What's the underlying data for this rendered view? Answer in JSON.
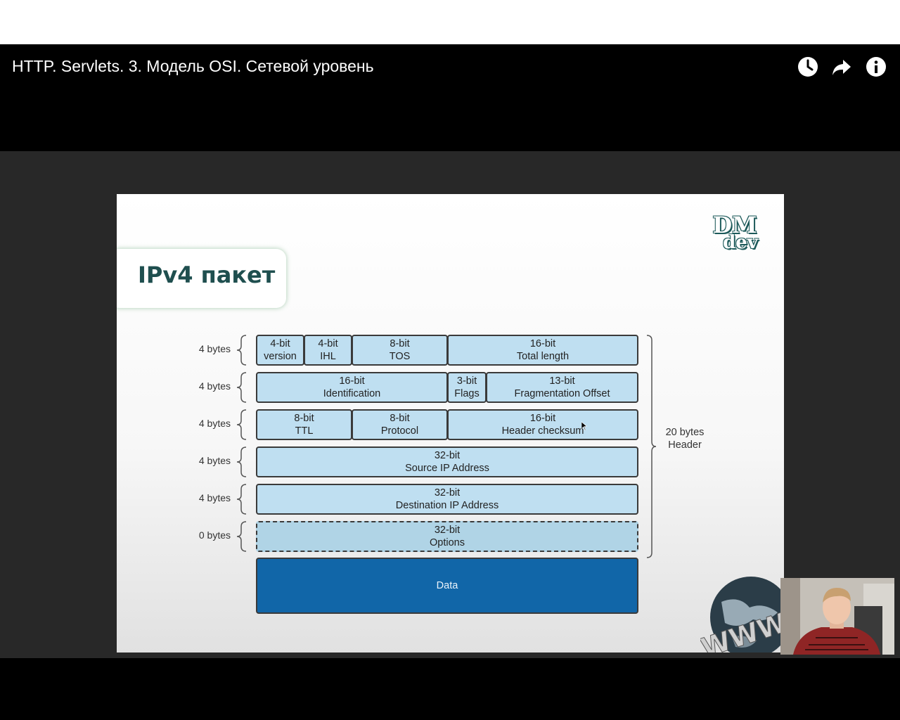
{
  "video": {
    "title": "HTTP. Servlets. 3. Модель OSI. Сетевой уровень",
    "icons": [
      "clock-icon",
      "share-icon",
      "info-icon"
    ]
  },
  "slide": {
    "title": "IPv4 пакет",
    "logo": {
      "line1": "DM",
      "line2": "dev"
    },
    "rows": [
      {
        "label": "4 bytes",
        "fields": [
          {
            "bits": "4-bit",
            "name": "version"
          },
          {
            "bits": "4-bit",
            "name": "IHL"
          },
          {
            "bits": "8-bit",
            "name": "TOS"
          },
          {
            "bits": "16-bit",
            "name": "Total length"
          }
        ]
      },
      {
        "label": "4 bytes",
        "fields": [
          {
            "bits": "16-bit",
            "name": "Identification"
          },
          {
            "bits": "3-bit",
            "name": "Flags"
          },
          {
            "bits": "13-bit",
            "name": "Fragmentation Offset"
          }
        ]
      },
      {
        "label": "4 bytes",
        "fields": [
          {
            "bits": "8-bit",
            "name": "TTL"
          },
          {
            "bits": "8-bit",
            "name": "Protocol"
          },
          {
            "bits": "16-bit",
            "name": "Header checksum"
          }
        ]
      },
      {
        "label": "4 bytes",
        "fields": [
          {
            "bits": "32-bit",
            "name": "Source IP Address"
          }
        ]
      },
      {
        "label": "4 bytes",
        "fields": [
          {
            "bits": "32-bit",
            "name": "Destination IP Address"
          }
        ]
      },
      {
        "label": "0 bytes",
        "fields": [
          {
            "bits": "32-bit",
            "name": "Options"
          }
        ]
      }
    ],
    "data_label": "Data",
    "header_summary": {
      "line1": "20 bytes",
      "line2": "Header"
    }
  },
  "colors": {
    "field_fill": "#bfdff1",
    "data_fill": "#1166a8",
    "title_color": "#1f4f4f"
  }
}
